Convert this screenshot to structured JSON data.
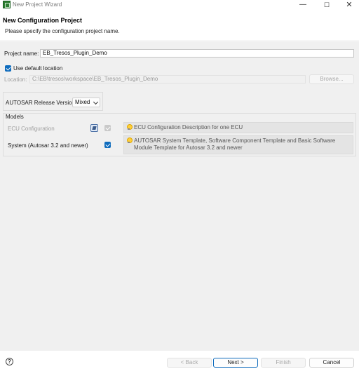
{
  "window": {
    "title": "New Project Wizard",
    "icon": "eb-tresos-icon",
    "minimize_glyph": "—",
    "maximize_glyph": "☐",
    "close_glyph": "✕"
  },
  "banner": {
    "title": "New Configuration Project",
    "message": "Please specify the configuration project name."
  },
  "project": {
    "name_label": "Project name:",
    "name_value": "EB_Tresos_Plugin_Demo",
    "use_default_location_label": "Use default location",
    "use_default_location_checked": true,
    "location_label": "Location:",
    "location_value": "C:\\EB\\tresos\\workspace\\EB_Tresos_Plugin_Demo",
    "browse_label": "Browse..."
  },
  "autosar": {
    "release_label": "AUTOSAR Release Version:",
    "release_value": "Mixed"
  },
  "models": {
    "group_label": "Models",
    "items": [
      {
        "name": "ECU Configuration",
        "enabled": false,
        "checked": true,
        "description": "ECU Configuration Description for one ECU"
      },
      {
        "name": "System (Autosar 3.2 and newer)",
        "enabled": true,
        "checked": true,
        "description": "AUTOSAR System Template, Software Component Template and Basic Software Module Template for Autosar 3.2 and newer"
      }
    ]
  },
  "footer": {
    "help_glyph": "?",
    "back_label": "< Back",
    "next_label": "Next >",
    "finish_label": "Finish",
    "cancel_label": "Cancel"
  },
  "colors": {
    "accent": "#0f6cbd",
    "content_bg": "#f0f0f0",
    "desc_bg": "#e4e4e4"
  }
}
